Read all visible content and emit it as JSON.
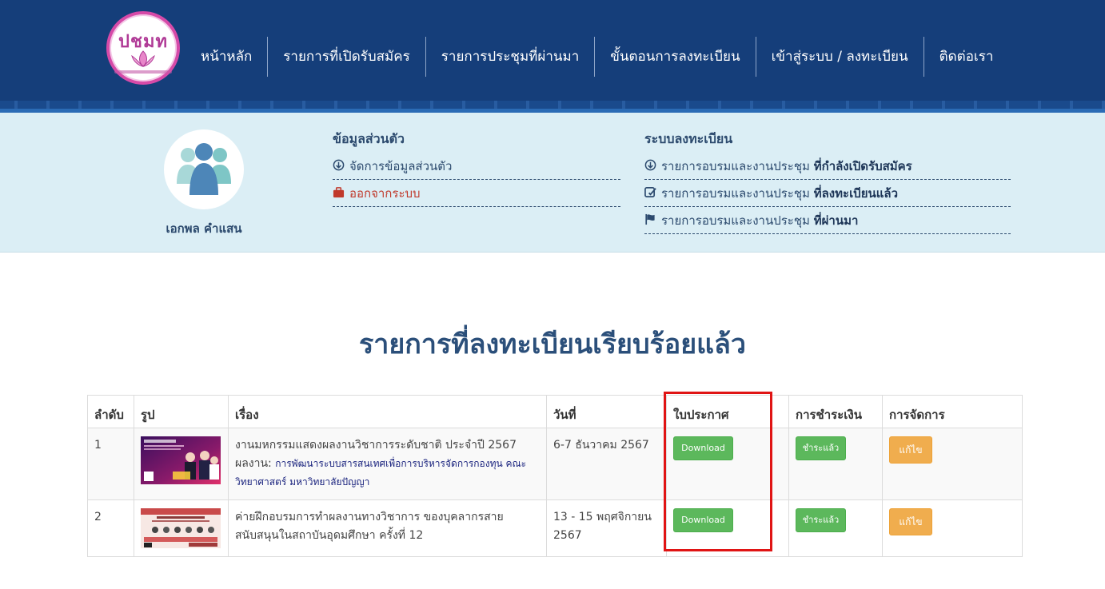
{
  "header": {
    "logo_text": "ปชมท",
    "nav": [
      {
        "label": "หน้าหลัก"
      },
      {
        "label": "รายการที่เปิดรับสมัคร"
      },
      {
        "label": "รายการประชุมที่ผ่านมา"
      },
      {
        "label": "ขั้นตอนการลงทะเบียน"
      },
      {
        "label": "เข้าสู่ระบบ / ลงทะเบียน"
      },
      {
        "label": "ติดต่อเรา"
      }
    ]
  },
  "profile": {
    "user_name": "เอกพล คำแสน",
    "personal": {
      "title": "ข้อมูลส่วนตัว",
      "links": [
        {
          "label": "จัดการข้อมูลส่วนตัว",
          "icon": "arrow-circle-down-icon"
        },
        {
          "label": "ออกจากระบบ",
          "icon": "briefcase-icon"
        }
      ]
    },
    "registration": {
      "title": "ระบบลงทะเบียน",
      "links": [
        {
          "prefix": "รายการอบรมและงานประชุม",
          "bold": "ที่กำลังเปิดรับสมัคร",
          "icon": "arrow-circle-down-icon"
        },
        {
          "prefix": "รายการอบรมและงานประชุม",
          "bold": "ที่ลงทะเบียนแล้ว",
          "icon": "edit-icon"
        },
        {
          "prefix": "รายการอบรมและงานประชุม",
          "bold": "ที่ผ่านมา",
          "icon": "flag-icon"
        }
      ]
    }
  },
  "main": {
    "title": "รายการที่ลงทะเบียนเรียบร้อยแล้ว",
    "table": {
      "headers": [
        "ลำดับ",
        "รูป",
        "เรื่อง",
        "วันที่",
        "ใบประกาศ",
        "การชำระเงิน",
        "การจัดการ"
      ],
      "rows": [
        {
          "no": "1",
          "title": "งานมหกรรมแสดงผลงานวิชาการระดับชาติ ประจำปี 2567",
          "work_prefix": "ผลงาน:",
          "work_link": "การพัฒนาระบบสารสนเทศเพื่อการบริหารจัดการกองทุน คณะวิทยาศาสตร์ มหาวิทยาลัยปัญญา",
          "date": "6-7 ธันวาคม 2567",
          "certificate_btn": "Download",
          "payment_btn": "ชำระแล้ว",
          "edit_btn": "แก้ไข"
        },
        {
          "no": "2",
          "title": "ค่ายฝึกอบรมการทำผลงานทางวิชาการ ของบุคลากรสายสนับสนุนในสถาบันอุดมศึกษา ครั้งที่ 12",
          "work_prefix": "",
          "work_link": "",
          "date": "13 - 15 พฤศจิกายน 2567",
          "certificate_btn": "Download",
          "payment_btn": "ชำระแล้ว",
          "edit_btn": "แก้ไข"
        }
      ]
    }
  },
  "colors": {
    "header_bg": "#153e7a",
    "profile_bg": "#dbeef5",
    "title_color": "#2b4f7a",
    "btn_green": "#5cb85c",
    "btn_orange": "#f0ad4e",
    "highlight": "#e01414"
  }
}
